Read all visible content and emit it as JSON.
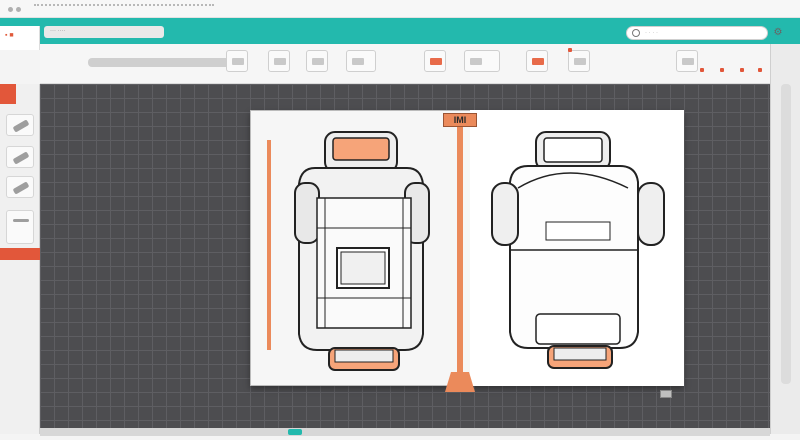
{
  "window": {
    "logo_label": "▪ ■"
  },
  "menu": {
    "file_label": "··· ····"
  },
  "search": {
    "placeholder": "· · · ·"
  },
  "ruler": {
    "label": "IMI"
  },
  "colors": {
    "accent_teal": "#23b9ad",
    "accent_orange": "#e2573a",
    "canvas_bg": "#4d4d50"
  },
  "icons": [
    "settings-icon",
    "search-icon",
    "select-tool-icon",
    "pen-tool-icon",
    "brush-tool-icon",
    "layers-icon",
    "align-icon",
    "export-icon"
  ]
}
